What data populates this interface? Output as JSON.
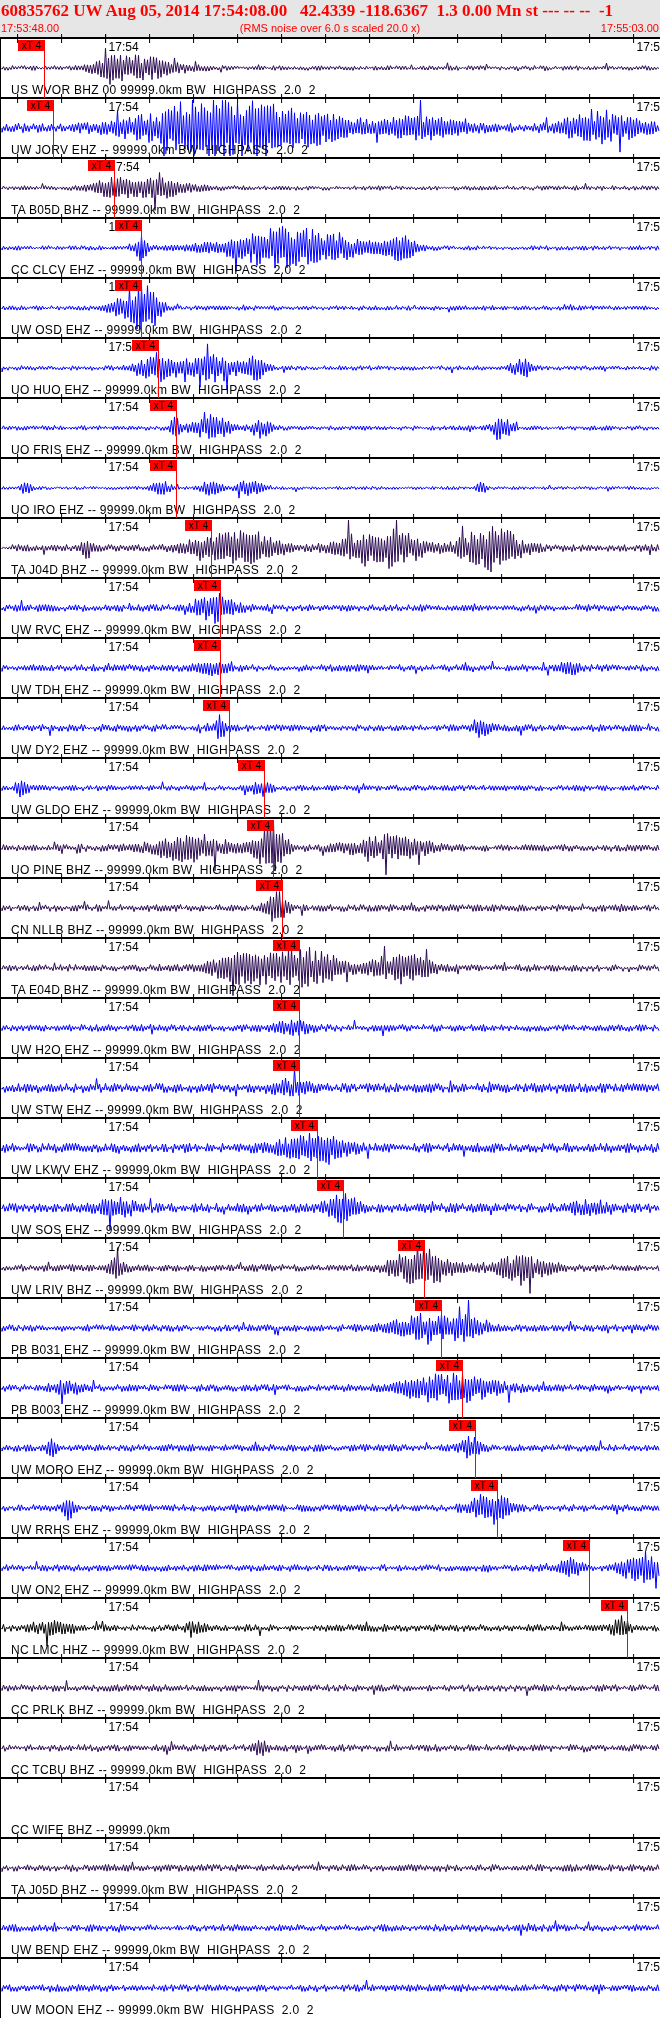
{
  "header": {
    "title": "60835762 UW Aug 05, 2014 17:54:08.00   42.4339 -118.6367  1.3 0.00 Mn st --- -- --  -1",
    "start_time": "17:53:48.00",
    "note": "(RMS noise over 6.0 s scaled 20.0 x)",
    "end_time": "17:55:03.00"
  },
  "traces": [
    {
      "label": "US WVOR BHZ 00 99999.0km BW  HIGHPASS  2.0  2",
      "time_label": "17:54",
      "end_label": "17:5",
      "color": "#2b0b52",
      "pick": "xT 4"
    },
    {
      "label": "UW JORV EHZ -- 99999.0km BW  HIGHPASS  2.0  2",
      "time_label": "17:54",
      "end_label": "17:5",
      "color": "#0000ff",
      "pick": "xT 4"
    },
    {
      "label": "TA B05D BHZ -- 99999.0km BW  HIGHPASS  2.0  2",
      "time_label": "7:54",
      "end_label": "17:5",
      "color": "#2b0b52",
      "pick": "xT 4"
    },
    {
      "label": "CC CLCV EHZ -- 99999.0km BW  HIGHPASS  2.0  2",
      "time_label": "1",
      "end_label": "17:5",
      "color": "#0000ff",
      "pick": "xT 4"
    },
    {
      "label": "UW OSD EHZ -- 99999.0km BW  HIGHPASS  2.0  2",
      "time_label": "1",
      "end_label": "17:5",
      "color": "#0000ff",
      "pick": "xT 4"
    },
    {
      "label": "UO HUO EHZ -- 99999.0km BW  HIGHPASS  2.0  2",
      "time_label": "17:5",
      "end_label": "17:5",
      "color": "#0000ff",
      "pick": "xT 4"
    },
    {
      "label": "UO FRIS EHZ -- 99999.0km BW  HIGHPASS  2.0  2",
      "time_label": "17:54",
      "end_label": "17:5",
      "color": "#0000ff",
      "pick": "xT 4"
    },
    {
      "label": "UO IRO EHZ -- 99999.0km BW  HIGHPASS  2.0  2",
      "time_label": "17:54",
      "end_label": "17:5",
      "color": "#0000ff",
      "pick": "xT 4"
    },
    {
      "label": "TA J04D BHZ -- 99999.0km BW  HIGHPASS  2.0  2",
      "time_label": "17:54",
      "end_label": "17:5",
      "color": "#2b0b52",
      "pick": "xT 4"
    },
    {
      "label": "UW RVC EHZ -- 99999.0km BW  HIGHPASS  2.0  2",
      "time_label": "17:54",
      "end_label": "17:5",
      "color": "#0000ff",
      "pick": "xT 4"
    },
    {
      "label": "UW TDH EHZ -- 99999.0km BW  HIGHPASS  2.0  2",
      "time_label": "17:54",
      "end_label": "17:5",
      "color": "#0000ff",
      "pick": "xT 4"
    },
    {
      "label": "UW DY2 EHZ -- 99999.0km BW  HIGHPASS  2.0  2",
      "time_label": "17:54",
      "end_label": "17:5",
      "color": "#0000ff",
      "pick": "xT 4"
    },
    {
      "label": "UW GLDO EHZ -- 99999.0km BW  HIGHPASS  2.0  2",
      "time_label": "17:54",
      "end_label": "17:5",
      "color": "#0000ff",
      "pick": "xT 4"
    },
    {
      "label": "UO PINE BHZ -- 99999.0km BW  HIGHPASS  2.0  2",
      "time_label": "17:54",
      "end_label": "17:5",
      "color": "#2b0b52",
      "pick": "xT 4"
    },
    {
      "label": "CN NLLB BHZ -- 99999.0km BW  HIGHPASS  2.0  2",
      "time_label": "17:54",
      "end_label": "17:5",
      "color": "#2b0b52",
      "pick": "xT 4"
    },
    {
      "label": "TA E04D BHZ -- 99999.0km BW  HIGHPASS  2.0  2",
      "time_label": "17:54",
      "end_label": "17:5",
      "color": "#2b0b52",
      "pick": "xT 4"
    },
    {
      "label": "UW H2O EHZ -- 99999.0km BW  HIGHPASS  2.0  2",
      "time_label": "17:54",
      "end_label": "17:5",
      "color": "#0000ff",
      "pick": "xT 4"
    },
    {
      "label": "UW STW EHZ -- 99999.0km BW  HIGHPASS  2.0  2",
      "time_label": "17:54",
      "end_label": "17:5",
      "color": "#0000ff",
      "pick": "xT 4"
    },
    {
      "label": "UW LKWV EHZ -- 99999.0km BW  HIGHPASS  2.0  2",
      "time_label": "17:54",
      "end_label": "17:5",
      "color": "#0000ff",
      "pick": "xT 4"
    },
    {
      "label": "UW SOS EHZ -- 99999.0km BW  HIGHPASS  2.0  2",
      "time_label": "17:54",
      "end_label": "17:5",
      "color": "#0000ff",
      "pick": "xT 4"
    },
    {
      "label": "UW LRIV BHZ -- 99999.0km BW  HIGHPASS  2.0  2",
      "time_label": "17:54",
      "end_label": "17:5",
      "color": "#2b0b52",
      "pick": "xT 4"
    },
    {
      "label": "PB B031 EHZ -- 99999.0km BW  HIGHPASS  2.0  2",
      "time_label": "17:54",
      "end_label": "17:5",
      "color": "#0000ff",
      "pick": "xT 4"
    },
    {
      "label": "PB B003 EHZ -- 99999.0km BW  HIGHPASS  2.0  2",
      "time_label": "17:54",
      "end_label": "17:5",
      "color": "#0000ff",
      "pick": "xT 4"
    },
    {
      "label": "UW MORO EHZ -- 99999.0km BW  HIGHPASS  2.0  2",
      "time_label": "17:54",
      "end_label": "17:5",
      "color": "#0000ff",
      "pick": "xT 4"
    },
    {
      "label": "UW RRHS EHZ -- 99999.0km BW  HIGHPASS  2.0  2",
      "time_label": "17:54",
      "end_label": "17:5",
      "color": "#0000ff",
      "pick": "xT 4"
    },
    {
      "label": "UW ON2 EHZ -- 99999.0km BW  HIGHPASS  2.0  2",
      "time_label": "17:54",
      "end_label": "17:5",
      "color": "#0000ff",
      "pick": "xT 4"
    },
    {
      "label": "NC LMC HHZ -- 99999.0km BW  HIGHPASS  2.0  2",
      "time_label": "17:54",
      "end_label": "17:5",
      "color": "#000000",
      "pick": "xT 4"
    },
    {
      "label": "CC PRLK BHZ -- 99999.0km BW  HIGHPASS  2.0  2",
      "time_label": "17:54",
      "end_label": "17:5",
      "color": "#2b0b52"
    },
    {
      "label": "CC TCBU BHZ -- 99999.0km BW  HIGHPASS  2.0  2",
      "time_label": "17:54",
      "end_label": "17:5",
      "color": "#2b0b52"
    },
    {
      "label": "CC WIFE BHZ -- 99999.0km",
      "time_label": "17:54",
      "end_label": "17:5"
    },
    {
      "label": "TA J05D BHZ -- 99999.0km BW  HIGHPASS  2.0  2",
      "time_label": "17:54",
      "end_label": "17:5",
      "color": "#2b0b52"
    },
    {
      "label": "UW BEND EHZ -- 99999.0km BW  HIGHPASS  2.0  2",
      "time_label": "17:54",
      "end_label": "17:5",
      "color": "#0000ff"
    },
    {
      "label": "UW MOON EHZ -- 99999.0km BW  HIGHPASS  2.0  2",
      "time_label": "17:54",
      "end_label": "17:5",
      "color": "#0000ff"
    }
  ]
}
